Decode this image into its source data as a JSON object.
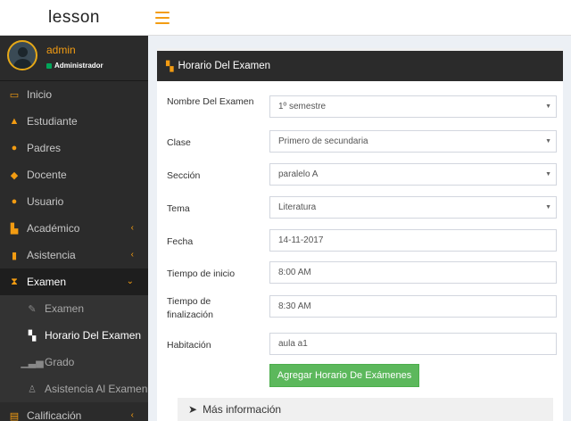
{
  "app": {
    "brand": "lesson"
  },
  "user": {
    "name": "admin",
    "role": "Administrador"
  },
  "sidebar": {
    "items": [
      {
        "label": "Inicio",
        "icon": "laptop-icon"
      },
      {
        "label": "Estudiante",
        "icon": "graduation-icon"
      },
      {
        "label": "Padres",
        "icon": "user-icon"
      },
      {
        "label": "Docente",
        "icon": "thumb-icon"
      },
      {
        "label": "Usuario",
        "icon": "users-icon"
      },
      {
        "label": "Académico",
        "icon": "bank-icon",
        "expandable": true
      },
      {
        "label": "Asistencia",
        "icon": "clipboard-icon",
        "expandable": true
      },
      {
        "label": "Examen",
        "icon": "hourglass-icon",
        "expandable": true,
        "expanded": true
      }
    ],
    "exam_sub": [
      {
        "label": "Examen",
        "icon": "pencil-icon"
      },
      {
        "label": "Horario Del Examen",
        "icon": "sitemap-icon",
        "current": true
      },
      {
        "label": "Grado",
        "icon": "signal-icon"
      },
      {
        "label": "Asistencia Al Examen",
        "icon": "person-icon"
      }
    ],
    "after": [
      {
        "label": "Calificación",
        "icon": "chart-icon",
        "expandable": true
      }
    ]
  },
  "panel": {
    "title": "Horario Del Examen",
    "fields": [
      {
        "label": "Nombre Del Examen",
        "value": "1º semestre",
        "type": "select"
      },
      {
        "label": "Clase",
        "value": "Primero de secundaria",
        "type": "select"
      },
      {
        "label": "Sección",
        "value": "paralelo A",
        "type": "select"
      },
      {
        "label": "Tema",
        "value": "Literatura",
        "type": "select"
      },
      {
        "label": "Fecha",
        "value": "14-11-2017",
        "type": "input"
      },
      {
        "label": "Tiempo de inicio",
        "value": "8:00 AM",
        "type": "input"
      },
      {
        "label": "Tiempo de finalización",
        "value": "8:30 AM",
        "type": "input"
      },
      {
        "label": "Habitación",
        "value": "aula a1",
        "type": "input"
      }
    ],
    "submit_label": "Agregar Horario De Exámenes",
    "more_label": "Más información"
  },
  "colors": {
    "accent": "#f39c12",
    "sidebar": "#2b2b2b",
    "success": "#5cb85c"
  }
}
